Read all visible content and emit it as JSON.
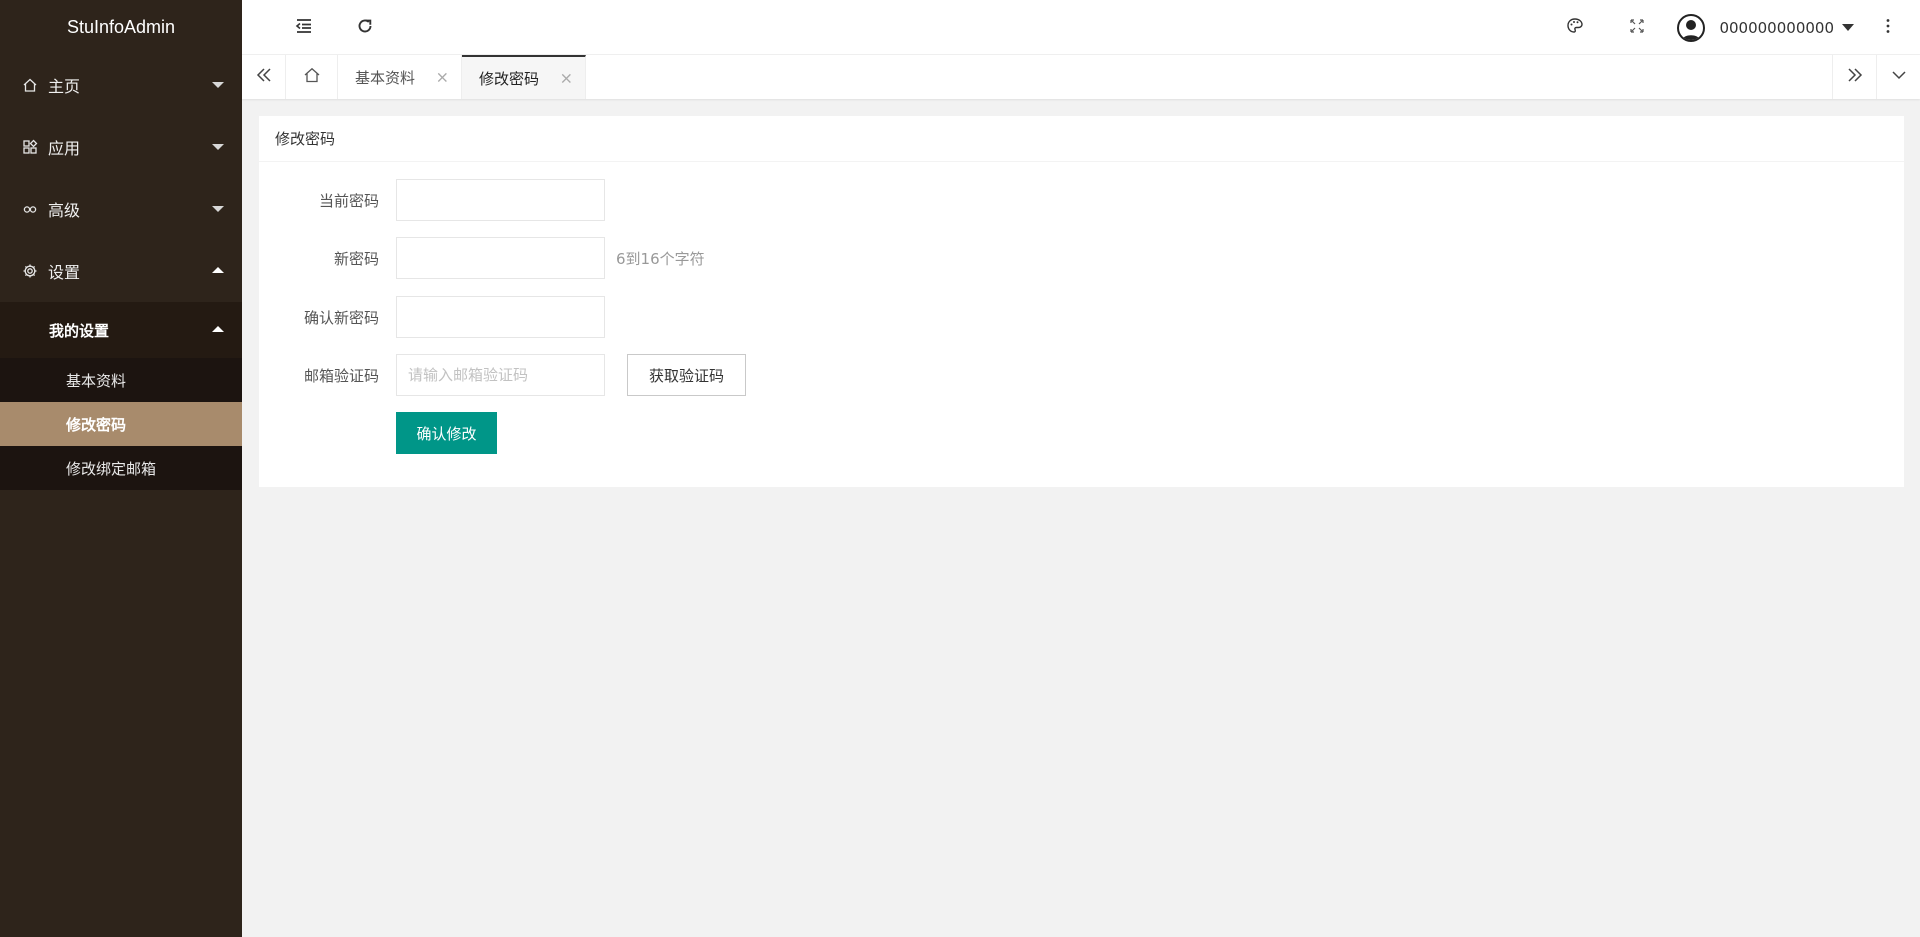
{
  "app": {
    "title": "StuInfoAdmin"
  },
  "sidebar": {
    "items": [
      {
        "label": "主页",
        "icon": "home-icon",
        "expanded": false
      },
      {
        "label": "应用",
        "icon": "apps-icon",
        "expanded": false
      },
      {
        "label": "高级",
        "icon": "senior-icon",
        "expanded": false
      },
      {
        "label": "设置",
        "icon": "gear-icon",
        "expanded": true
      }
    ],
    "settings_group": {
      "label": "我的设置",
      "expanded": true,
      "children": [
        {
          "label": "基本资料",
          "active": false
        },
        {
          "label": "修改密码",
          "active": true
        },
        {
          "label": "修改绑定邮箱",
          "active": false
        }
      ]
    }
  },
  "header": {
    "user_name": "000000000000",
    "icons": [
      "shrink-menu-icon",
      "refresh-icon",
      "theme-palette-icon",
      "fullscreen-icon",
      "avatar-icon",
      "more-vertical-icon"
    ]
  },
  "tabs": {
    "items": [
      {
        "label": "基本资料",
        "active": false
      },
      {
        "label": "修改密码",
        "active": true
      }
    ],
    "close_symbol": "×"
  },
  "card": {
    "title": "修改密码",
    "fields": {
      "current_password": {
        "label": "当前密码",
        "value": "",
        "placeholder": ""
      },
      "new_password": {
        "label": "新密码",
        "value": "",
        "placeholder": "",
        "hint": "6到16个字符"
      },
      "confirm_password": {
        "label": "确认新密码",
        "value": "",
        "placeholder": ""
      },
      "email_code": {
        "label": "邮箱验证码",
        "value": "",
        "placeholder": "请输入邮箱验证码"
      }
    },
    "get_code_label": "获取验证码",
    "submit_label": "确认修改"
  },
  "colors": {
    "sidebar_bg": "#2e241b",
    "submenu_bg": "#1c1410",
    "active_item_bg": "#a88b6c",
    "primary_button": "#009688"
  }
}
